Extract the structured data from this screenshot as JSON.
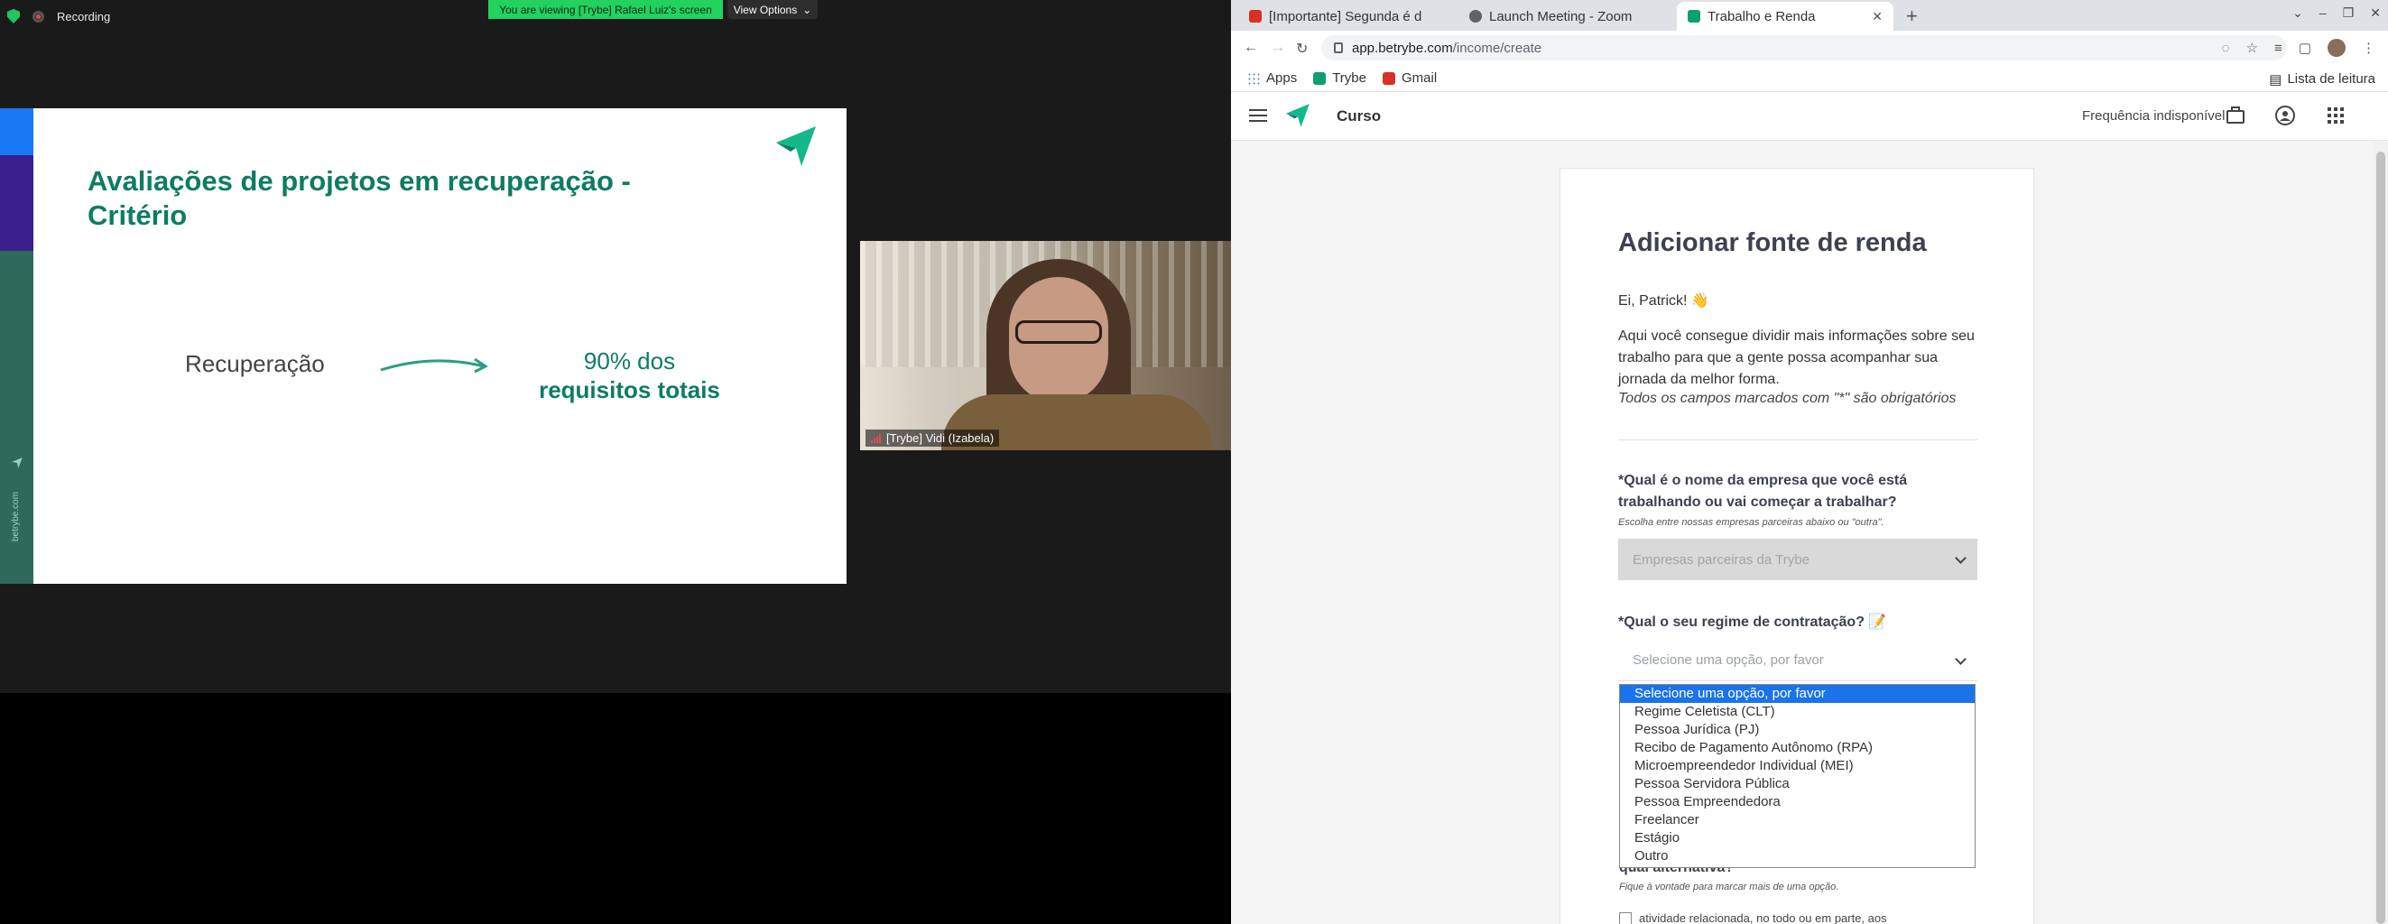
{
  "zoom": {
    "recording_label": "Recording",
    "viewing_banner": "You are viewing [Trybe] Rafael Luiz's screen",
    "view_options": "View Options",
    "slide": {
      "title": "Avaliações de projetos em recuperação -\nCritério",
      "left_text": "Recuperação",
      "right_line1": "90% dos",
      "right_line2": "requisitos totais",
      "vertical_text": "betrybe.com"
    },
    "speaker_name": "[Trybe] Vidi (Izabela)"
  },
  "browser": {
    "tabs": [
      {
        "label": "[Importante] Segunda é d",
        "favicon_color": "#d93025"
      },
      {
        "label": "Launch Meeting - Zoom",
        "favicon_color": "#5f6368"
      },
      {
        "label": "Trabalho e Renda",
        "favicon_color": "#0e9f6e"
      }
    ],
    "url_host": "app.betrybe.com",
    "url_path": "/income/create",
    "bookmarks": [
      "Apps",
      "Trybe",
      "Gmail"
    ],
    "reading_list": "Lista de leitura"
  },
  "app": {
    "section": "Curso",
    "frequency": "Frequência indisponível",
    "form": {
      "title": "Adicionar fonte de renda",
      "greeting": "Ei, Patrick! 👋",
      "intro": "Aqui você consegue dividir mais informações sobre seu trabalho para que a gente possa acompanhar sua jornada da melhor forma.",
      "required_note": "Todos os campos marcados com \"*\" são obrigatórios",
      "q1": "*Qual é o nome da empresa que você está trabalhando ou vai começar a trabalhar?",
      "q1_hint": "Escolha entre nossas empresas parceiras abaixo ou \"outra\".",
      "q1_placeholder": "Empresas parceiras da Trybe",
      "q2": "*Qual o seu regime de contratação? 📝",
      "q2_placeholder": "Selecione uma opção, por favor",
      "q2_options": [
        "Selecione uma opção, por favor",
        "Regime Celetista (CLT)",
        "Pessoa Jurídica (PJ)",
        "Recibo de Pagamento Autônomo (RPA)",
        "Microempreendedor Individual (MEI)",
        "Pessoa Servidora Pública",
        "Pessoa Empreendedora",
        "Freelancer",
        "Estágio",
        "Outro"
      ],
      "q3_tail": "qual alternativa?",
      "q3_hint": "Fique à vontade para marcar mais de uma opção.",
      "q3_option1": "atividade relacionada, no todo ou em parte, aos"
    }
  }
}
